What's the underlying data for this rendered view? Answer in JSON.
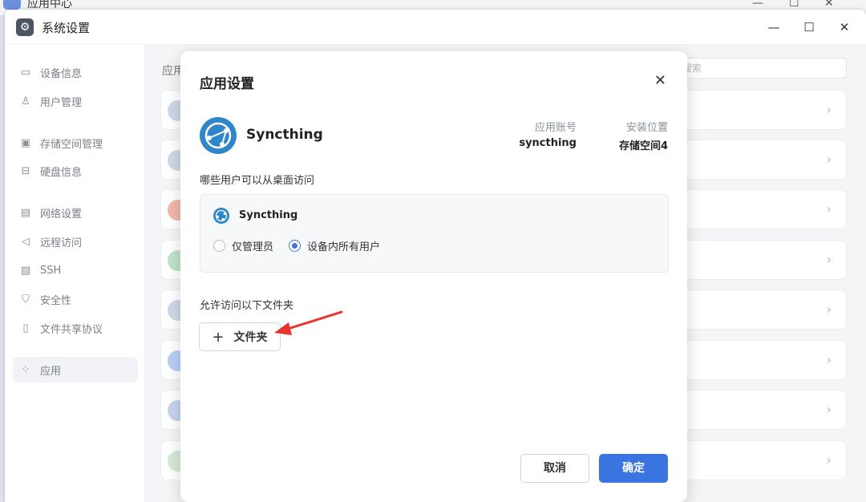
{
  "background_window": {
    "title": "应用中心"
  },
  "window": {
    "title": "系统设置"
  },
  "sidebar": {
    "items": [
      {
        "label": "设备信息",
        "icon": "device-icon"
      },
      {
        "label": "用户管理",
        "icon": "user-icon"
      },
      {
        "label": "存储空间管理",
        "icon": "storage-icon"
      },
      {
        "label": "硬盘信息",
        "icon": "disk-icon"
      },
      {
        "label": "网络设置",
        "icon": "network-icon"
      },
      {
        "label": "远程访问",
        "icon": "remote-icon"
      },
      {
        "label": "SSH",
        "icon": "ssh-icon"
      },
      {
        "label": "安全性",
        "icon": "shield-icon"
      },
      {
        "label": "文件共享协议",
        "icon": "file-share-icon"
      },
      {
        "label": "应用",
        "icon": "apps-icon",
        "active": true
      }
    ]
  },
  "content": {
    "section_title": "应用",
    "search_placeholder": "搜索"
  },
  "dialog": {
    "title": "应用设置",
    "app_name": "Syncthing",
    "account_label": "应用账号",
    "account_value": "syncthing",
    "location_label": "安装位置",
    "location_value": "存储空间4",
    "access_question": "哪些用户可以从桌面访问",
    "access_app_name": "Syncthing",
    "option_admin": "仅管理员",
    "option_all": "设备内所有用户",
    "selected_option": "option_all",
    "folder_label": "允许访问以下文件夹",
    "folder_button": "文件夹",
    "cancel_button": "取消",
    "ok_button": "确定"
  },
  "colors": {
    "accent": "#3a74e0",
    "annotation_arrow": "#e8342a",
    "app_logo": "#2f86c9"
  }
}
